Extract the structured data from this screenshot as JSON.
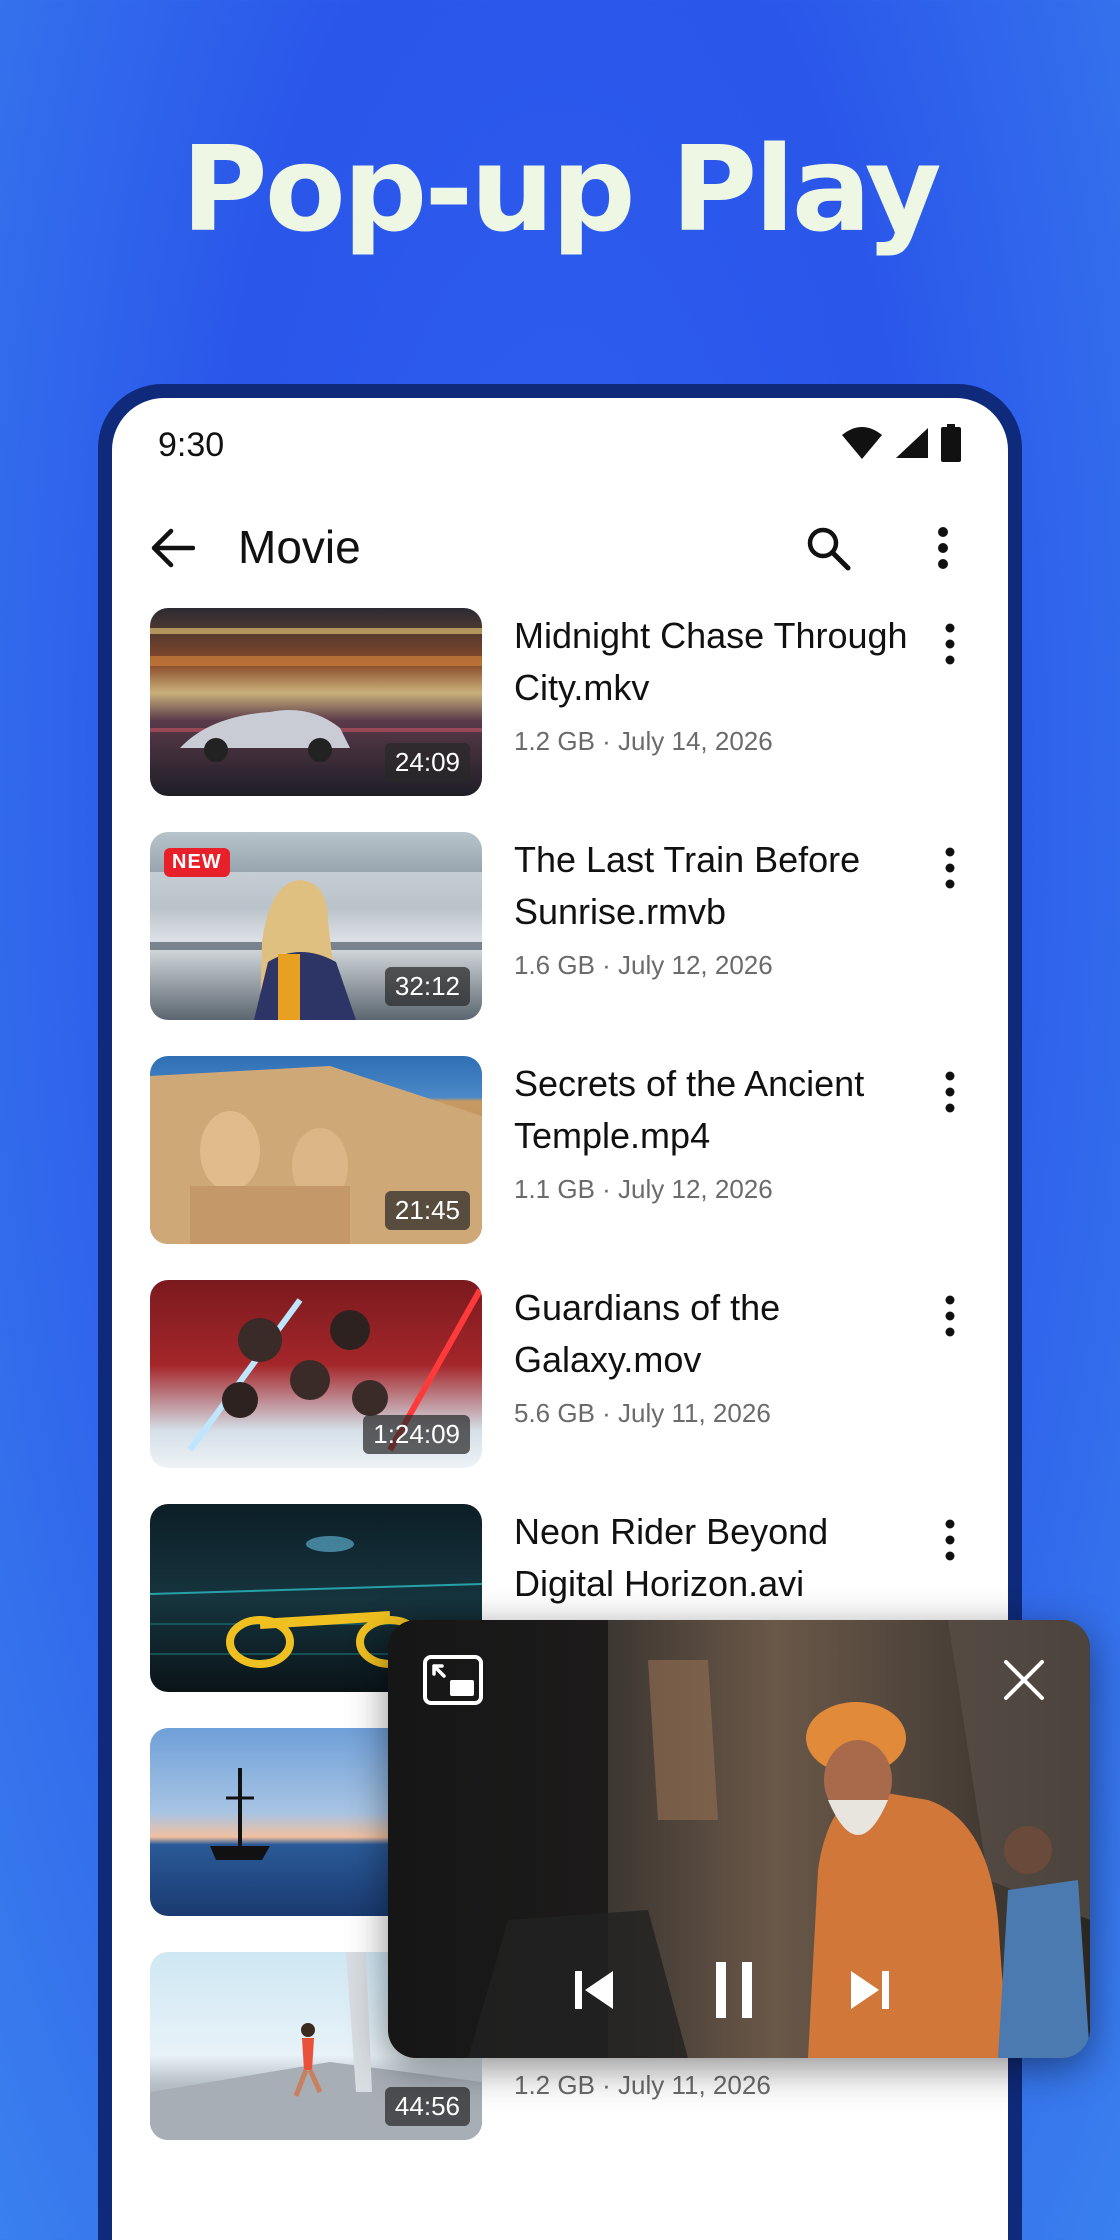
{
  "headline": "Pop-up Play",
  "status_bar": {
    "time": "9:30"
  },
  "app_bar": {
    "title": "Movie"
  },
  "videos": [
    {
      "title": "Midnight Chase Through City.mkv",
      "meta": "1.2 GB · July 14, 2026",
      "duration": "24:09",
      "badge": ""
    },
    {
      "title": "The Last Train Before Sunrise.rmvb",
      "meta": "1.6 GB · July 12, 2026",
      "duration": "32:12",
      "badge": "NEW"
    },
    {
      "title": "Secrets of the Ancient Temple.mp4",
      "meta": "1.1 GB · July 12, 2026",
      "duration": "21:45",
      "badge": ""
    },
    {
      "title": "Guardians of the Galaxy.mov",
      "meta": "5.6 GB · July 11, 2026",
      "duration": "1:24:09",
      "badge": ""
    },
    {
      "title": "Neon Rider Beyond Digital Horizon.avi",
      "meta": "",
      "duration": "",
      "badge": ""
    },
    {
      "title": "",
      "meta": "",
      "duration": "",
      "badge": ""
    },
    {
      "title": "",
      "meta": "1.2 GB · July 11, 2026",
      "duration": "44:56",
      "badge": ""
    }
  ],
  "colors": {
    "background": "#2a56ea",
    "headline": "#eef7e4",
    "phone_frame": "#0f2a7a",
    "badge": "#e8202a"
  },
  "icons": {
    "back": "arrow-left-icon",
    "search": "search-icon",
    "more": "more-vert-icon",
    "popup_expand": "picture-in-picture-exit-icon",
    "popup_close": "close-icon",
    "prev": "skip-previous-icon",
    "pause": "pause-icon",
    "next": "skip-next-icon"
  }
}
